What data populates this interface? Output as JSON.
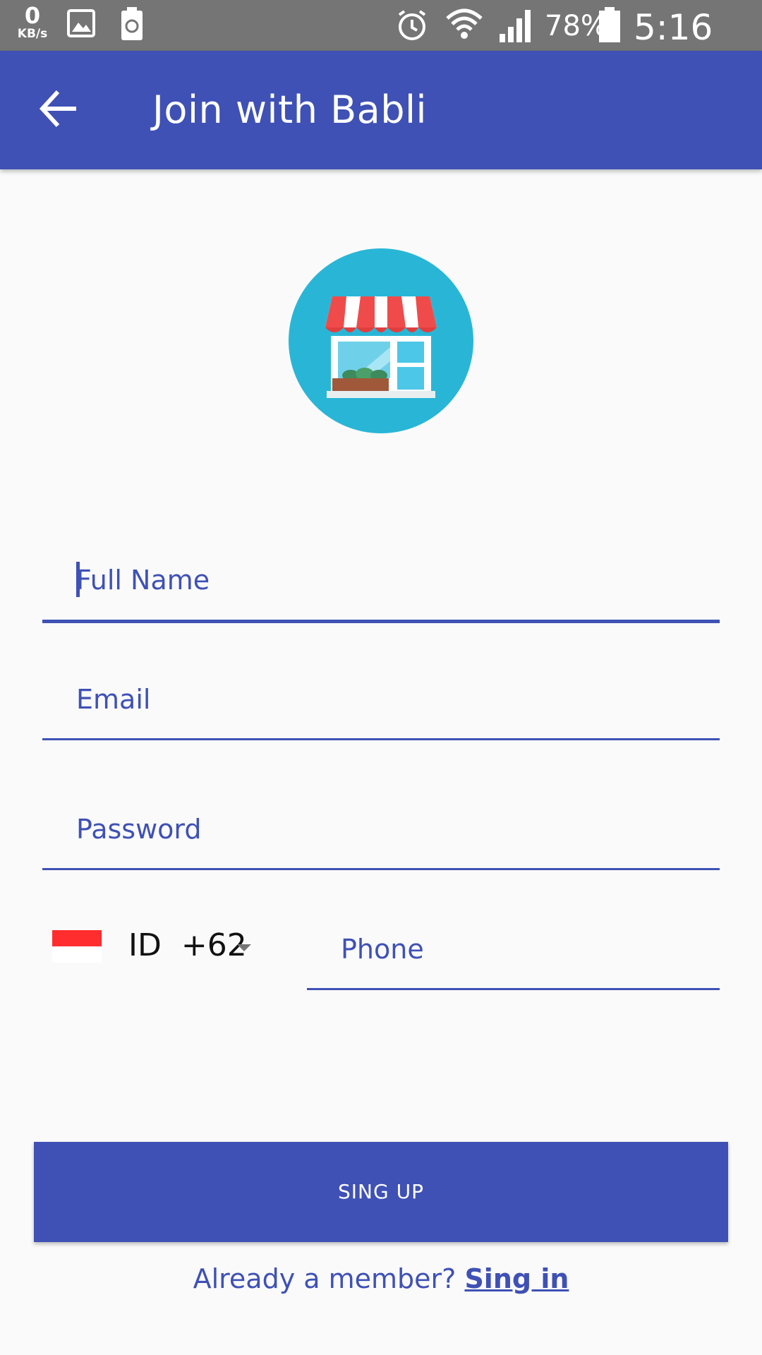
{
  "status_bar": {
    "network_speed_value": "0",
    "network_speed_unit": "KB/s",
    "battery_percent": "78%",
    "time": "5:16 AM",
    "icons": [
      "gallery-icon",
      "battery-saver-icon",
      "alarm-icon",
      "wifi-icon",
      "signal-icon",
      "battery-icon"
    ]
  },
  "app_bar": {
    "title": "Join with Babli",
    "back_icon": "arrow-back-icon"
  },
  "logo": {
    "icon": "storefront-icon"
  },
  "form": {
    "full_name_placeholder": "Full Name",
    "email_placeholder": "Email",
    "password_placeholder": "Password",
    "country_code": "ID  +62",
    "phone_placeholder": "Phone"
  },
  "signup_button_label": "SING UP",
  "signin": {
    "prompt": "Already a member?",
    "link": "Sing in"
  },
  "colors": {
    "primary": "#3f51b5",
    "status_bar": "#757575",
    "background": "#fafafa",
    "logo_circle": "#29b6d6"
  }
}
